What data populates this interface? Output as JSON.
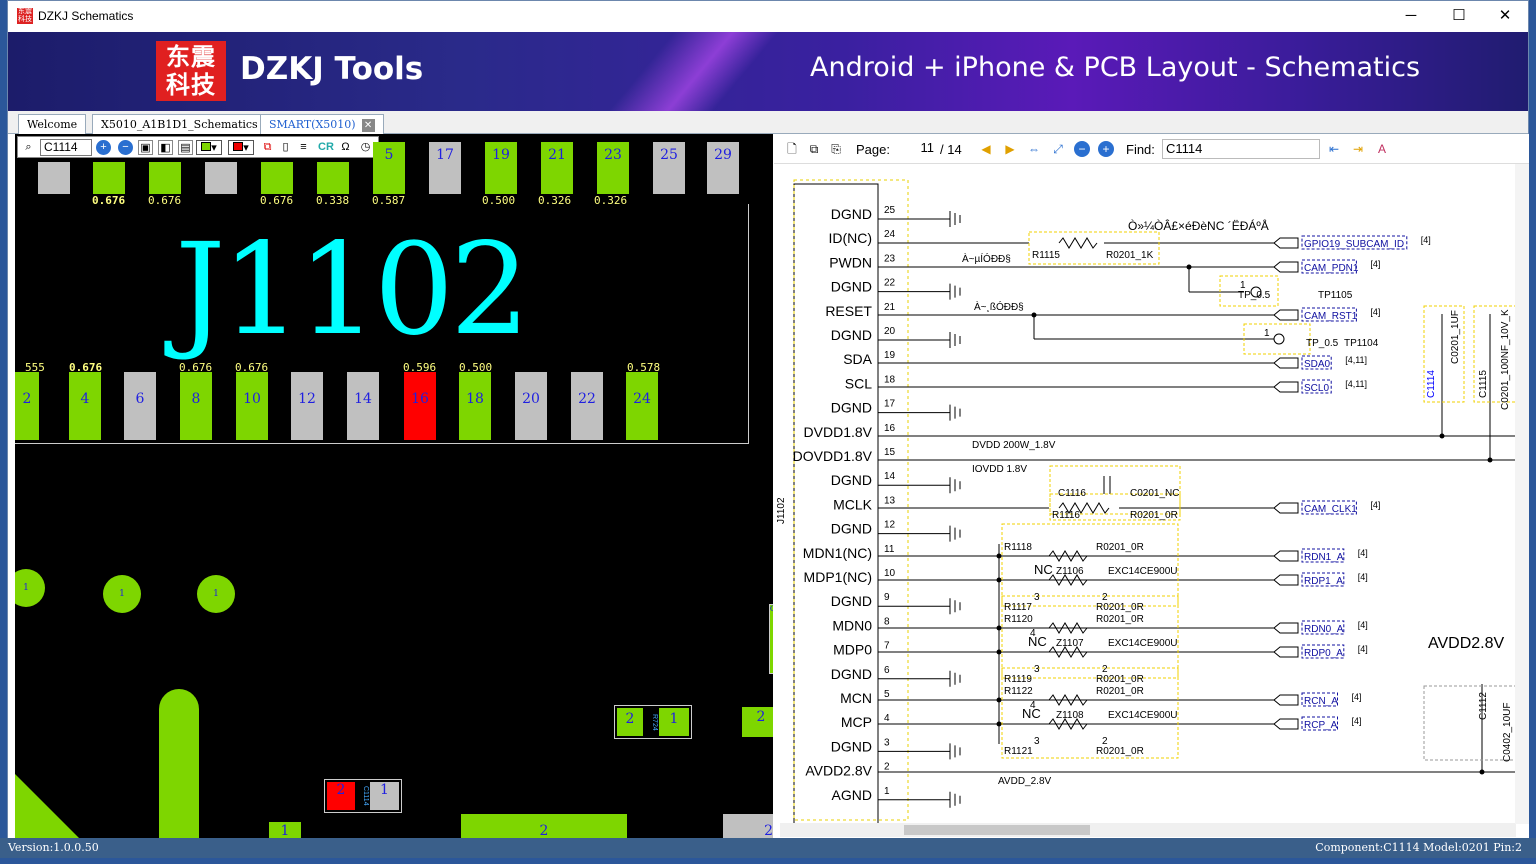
{
  "window": {
    "title": "DZKJ Schematics",
    "minimize": "─",
    "maximize": "☐",
    "close": "✕"
  },
  "banner": {
    "logo_text": "东震科技",
    "title": "DZKJ Tools",
    "subtitle": "Android + iPhone & PCB Layout - Schematics"
  },
  "tabs": [
    {
      "label": "Welcome"
    },
    {
      "label": "X5010_A1B1D1_Schematics"
    },
    {
      "label": "SMART(X5010)"
    }
  ],
  "pcb": {
    "search_value": "C1114",
    "ref_designator": "J1102",
    "top_pads": [
      "5",
      "17",
      "19",
      "21",
      "23",
      "25",
      "29"
    ],
    "top_values": [
      "0.676",
      "0.676",
      "0.676",
      "0.338",
      "0.587",
      "0.500",
      "0.326",
      "0.326"
    ],
    "bottom_pads": [
      "2",
      "4",
      "6",
      "8",
      "10",
      "12",
      "14",
      "16",
      "18",
      "20",
      "22",
      "24"
    ],
    "bottom_values": [
      "555",
      "0.676",
      "0.676",
      "0.676",
      "0.596",
      "0.500",
      "0.578"
    ],
    "vias": [
      "1",
      "1",
      "1"
    ],
    "comp_r724": {
      "label": "R724",
      "pin_a": "2",
      "pin_b": "1"
    },
    "comp_c1114": {
      "label": "C1114",
      "pin_a": "2",
      "pin_b": "1"
    },
    "misc_pads": [
      "2",
      "1",
      "2",
      "2",
      "C1"
    ]
  },
  "schematic": {
    "page_label": "Page:",
    "page_current": "11",
    "page_total": "/ 14",
    "find_label": "Find:",
    "find_value": "C1114",
    "connector_ref": "J1102",
    "pins": [
      {
        "name": "DGND",
        "num": "25"
      },
      {
        "name": "ID(NC)",
        "num": "24"
      },
      {
        "name": "PWDN",
        "num": "23"
      },
      {
        "name": "DGND",
        "num": "22"
      },
      {
        "name": "RESET",
        "num": "21"
      },
      {
        "name": "DGND",
        "num": "20"
      },
      {
        "name": "SDA",
        "num": "19"
      },
      {
        "name": "SCL",
        "num": "18"
      },
      {
        "name": "DGND",
        "num": "17"
      },
      {
        "name": "DVDD1.8V",
        "num": "16"
      },
      {
        "name": "DOVDD1.8V",
        "num": "15"
      },
      {
        "name": "DGND",
        "num": "14"
      },
      {
        "name": "MCLK",
        "num": "13"
      },
      {
        "name": "DGND",
        "num": "12"
      },
      {
        "name": "MDN1(NC)",
        "num": "11"
      },
      {
        "name": "MDP1(NC)",
        "num": "10"
      },
      {
        "name": "DGND",
        "num": "9"
      },
      {
        "name": "MDN0",
        "num": "8"
      },
      {
        "name": "MDP0",
        "num": "7"
      },
      {
        "name": "DGND",
        "num": "6"
      },
      {
        "name": "MCN",
        "num": "5"
      },
      {
        "name": "MCP",
        "num": "4"
      },
      {
        "name": "DGND",
        "num": "3"
      },
      {
        "name": "AVDD2.8V",
        "num": "2"
      },
      {
        "name": "AGND",
        "num": "1"
      }
    ],
    "nets": [
      {
        "label": "GPIO19_SUBCAM_ID",
        "ref": "[4]"
      },
      {
        "label": "CAM_PDN1",
        "ref": "[4]"
      },
      {
        "label": "CAM_RST1",
        "ref": "[4]"
      },
      {
        "label": "SDA0",
        "ref": "[4,11]"
      },
      {
        "label": "SCL0",
        "ref": "[4,11]"
      },
      {
        "label": "CAM_CLK1",
        "ref": "[4]"
      },
      {
        "label": "RDN1_A",
        "ref": "[4]"
      },
      {
        "label": "RDP1_A",
        "ref": "[4]"
      },
      {
        "label": "RDN0_A",
        "ref": "[4]"
      },
      {
        "label": "RDP0_A",
        "ref": "[4]"
      },
      {
        "label": "RCN_A",
        "ref": "[4]"
      },
      {
        "label": "RCP_A",
        "ref": "[4]"
      }
    ],
    "garbled_note": "Ò»¼ÒÂ£×éÐèNC ´ËÐÁºÅ",
    "note_a": "À~µÍÓÐÐ§",
    "note_b": "À~¸ßÓÐÐ§",
    "r1115": "R1115",
    "r1115_val": "R0201_1K",
    "tp1105": "TP1105",
    "tp1104": "TP1104",
    "tp_val": "TP_0.5",
    "dvdd_net": "DVDD 200W_1.8V",
    "iovdd_net": "IOVDD 1.8V",
    "avdd_net": "AVDD_2.8V",
    "c1116": "C1116",
    "c1116_val": "C0201_NC",
    "r1116": "R1116",
    "r1116_val": "R0201_0R",
    "r1118": "R1118",
    "r1117": "R1117",
    "r1120": "R1120",
    "r1119": "R1119",
    "r1122": "R1122",
    "r1121": "R1121",
    "r_0r": "R0201_0R",
    "z1106": "Z1106",
    "z1107": "Z1107",
    "z1108": "Z1108",
    "z_val": "EXC14CE900U",
    "nc": "NC",
    "pin1": "1",
    "pin2": "2",
    "pin3": "3",
    "pin4": "4",
    "c1114": "C1114",
    "c1114_val": "C0201_1UF",
    "c1115": "C1115",
    "c1115_val": "C0201_100NF_10V_K",
    "avdd_title": "AVDD2.8V",
    "c1112": "C1112",
    "c1112_val": "C0402_10UF"
  },
  "status": {
    "version": "Version:1.0.0.50",
    "component": "Component:C1114 Model:0201 Pin:2"
  },
  "colors": {
    "pad_green": "#7ed600",
    "pad_gray": "#c0c0c0",
    "pad_red": "#ff0000",
    "ref_cyan": "#00ffff",
    "net_blue": "#1010a0",
    "yellow_box": "#f0d000"
  }
}
